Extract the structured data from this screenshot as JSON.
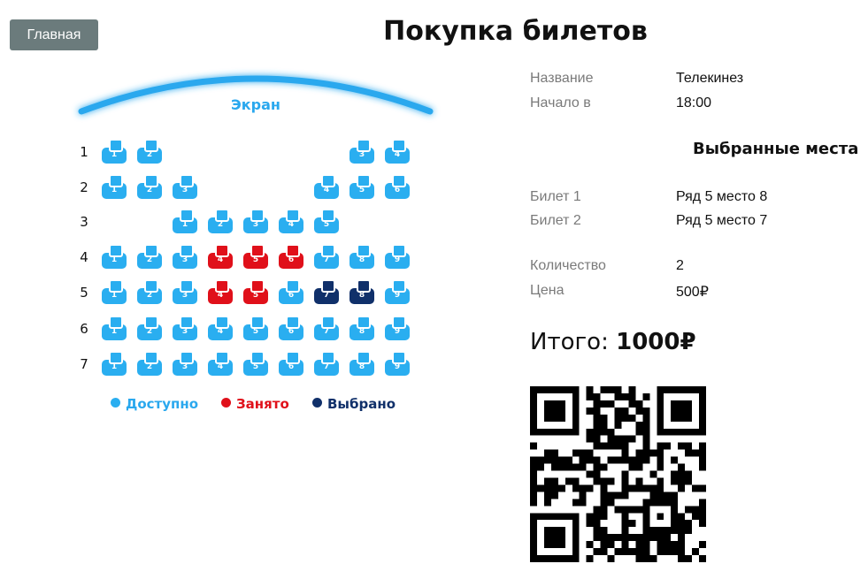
{
  "nav": {
    "home_label": "Главная"
  },
  "page": {
    "title": "Покупка билетов"
  },
  "hall": {
    "screen_label": "Экран",
    "rows": [
      {
        "label": "1",
        "seats": [
          {
            "num": "1",
            "status": "available"
          },
          {
            "num": "2",
            "status": "available"
          },
          {
            "num": "3",
            "status": "available"
          },
          {
            "num": "4",
            "status": "available"
          }
        ]
      },
      {
        "label": "2",
        "seats": [
          {
            "num": "1",
            "status": "available"
          },
          {
            "num": "2",
            "status": "available"
          },
          {
            "num": "3",
            "status": "available"
          },
          {
            "num": "4",
            "status": "available"
          },
          {
            "num": "5",
            "status": "available"
          },
          {
            "num": "6",
            "status": "available"
          }
        ]
      },
      {
        "label": "3",
        "seats": [
          {
            "num": "1",
            "status": "available"
          },
          {
            "num": "2",
            "status": "available"
          },
          {
            "num": "3",
            "status": "available"
          },
          {
            "num": "4",
            "status": "available"
          },
          {
            "num": "5",
            "status": "available"
          }
        ]
      },
      {
        "label": "4",
        "seats": [
          {
            "num": "1",
            "status": "available"
          },
          {
            "num": "2",
            "status": "available"
          },
          {
            "num": "3",
            "status": "available"
          },
          {
            "num": "4",
            "status": "taken"
          },
          {
            "num": "5",
            "status": "taken"
          },
          {
            "num": "6",
            "status": "taken"
          },
          {
            "num": "7",
            "status": "available"
          },
          {
            "num": "8",
            "status": "available"
          },
          {
            "num": "9",
            "status": "available"
          }
        ]
      },
      {
        "label": "5",
        "seats": [
          {
            "num": "1",
            "status": "available"
          },
          {
            "num": "2",
            "status": "available"
          },
          {
            "num": "3",
            "status": "available"
          },
          {
            "num": "4",
            "status": "taken"
          },
          {
            "num": "5",
            "status": "taken"
          },
          {
            "num": "6",
            "status": "available"
          },
          {
            "num": "7",
            "status": "selected"
          },
          {
            "num": "8",
            "status": "selected"
          },
          {
            "num": "9",
            "status": "available"
          }
        ]
      },
      {
        "label": "6",
        "seats": [
          {
            "num": "1",
            "status": "available"
          },
          {
            "num": "2",
            "status": "available"
          },
          {
            "num": "3",
            "status": "available"
          },
          {
            "num": "4",
            "status": "available"
          },
          {
            "num": "5",
            "status": "available"
          },
          {
            "num": "6",
            "status": "available"
          },
          {
            "num": "7",
            "status": "available"
          },
          {
            "num": "8",
            "status": "available"
          },
          {
            "num": "9",
            "status": "available"
          }
        ]
      },
      {
        "label": "7",
        "seats": [
          {
            "num": "1",
            "status": "available"
          },
          {
            "num": "2",
            "status": "available"
          },
          {
            "num": "3",
            "status": "available"
          },
          {
            "num": "4",
            "status": "available"
          },
          {
            "num": "5",
            "status": "available"
          },
          {
            "num": "6",
            "status": "available"
          },
          {
            "num": "7",
            "status": "available"
          },
          {
            "num": "8",
            "status": "available"
          },
          {
            "num": "9",
            "status": "available"
          }
        ]
      }
    ],
    "legend": {
      "available": "Доступно",
      "taken": "Занято",
      "selected": "Выбрано"
    }
  },
  "colors": {
    "available": "#2aaef0",
    "taken": "#e0101a",
    "selected": "#10306a",
    "screen": "#2aa8ee"
  },
  "movie": {
    "title_label": "Название",
    "title_value": "Телекинез",
    "start_label": "Начало в",
    "start_value": "18:00"
  },
  "selection": {
    "section_title": "Выбранные места",
    "tickets": [
      {
        "label": "Билет 1",
        "value": "Ряд 5 место 8"
      },
      {
        "label": "Билет 2",
        "value": "Ряд 5 место 7"
      }
    ],
    "quantity_label": "Количество",
    "quantity_value": "2",
    "price_label": "Цена",
    "price_value": "500₽",
    "total_label": "Итого:",
    "total_value": "1000₽"
  },
  "qr": {
    "icon": "qr-code-icon"
  }
}
